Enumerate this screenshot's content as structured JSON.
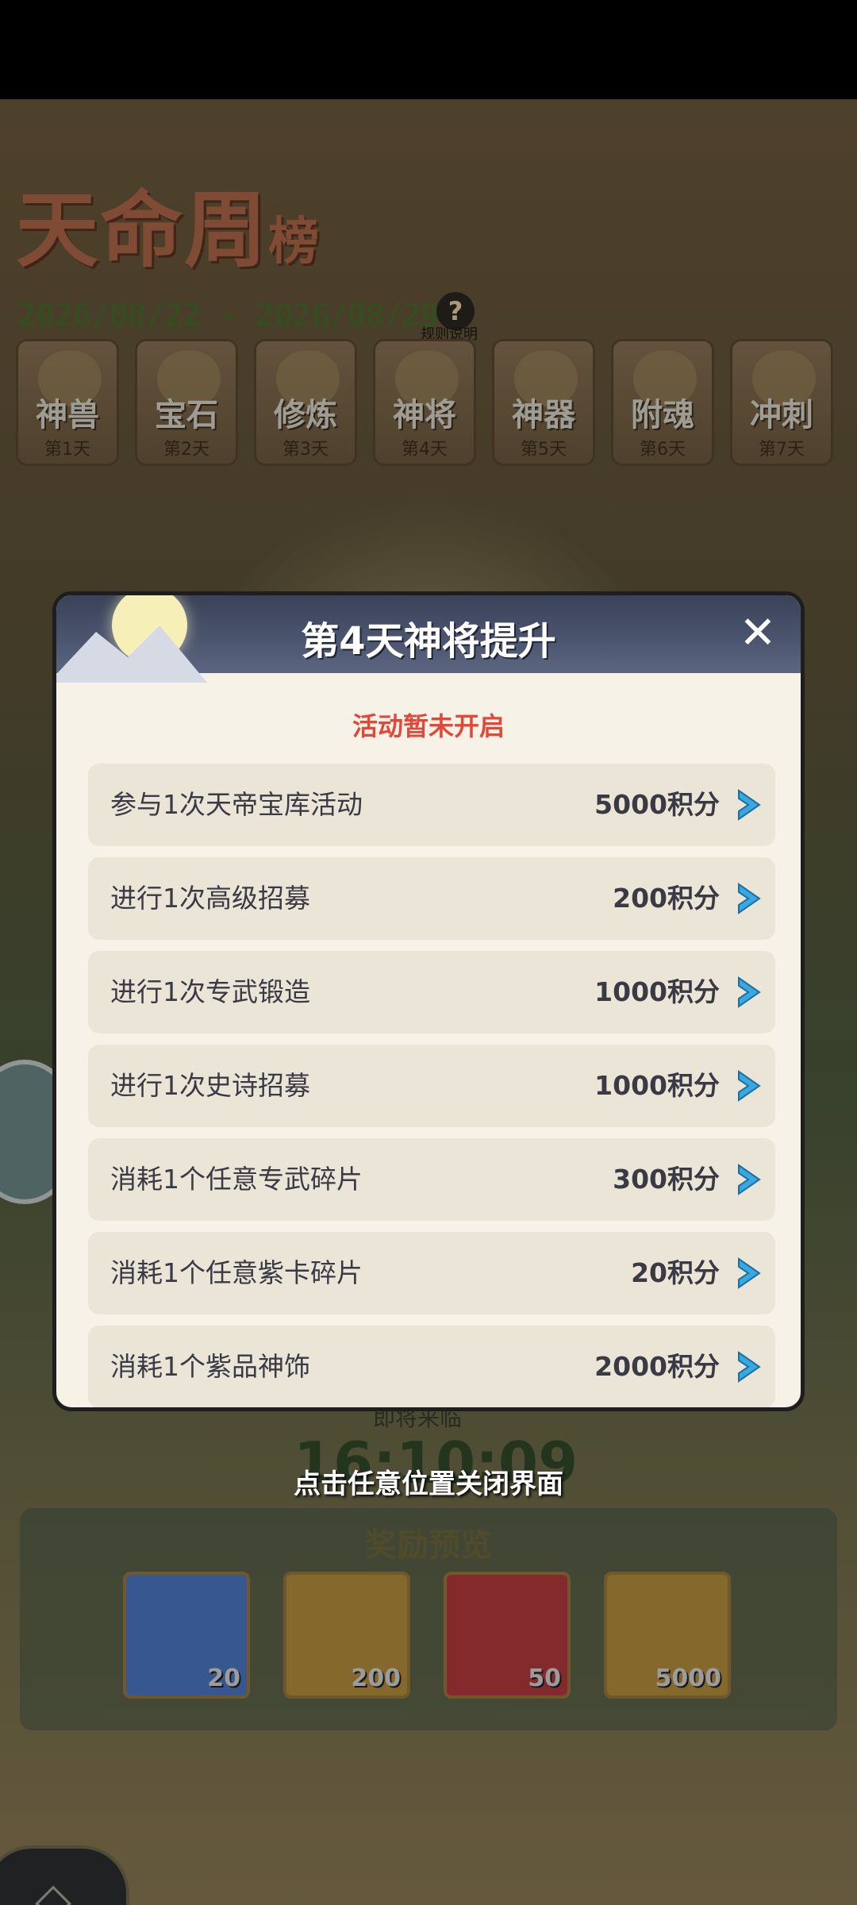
{
  "background": {
    "title_main": "天命周",
    "title_small": "榜",
    "date_range": "2026/08/22 - 2026/08/29",
    "help_label": "规则说明",
    "day_tabs": [
      {
        "name": "神兽",
        "day": "第1天"
      },
      {
        "name": "宝石",
        "day": "第2天"
      },
      {
        "name": "修炼",
        "day": "第3天"
      },
      {
        "name": "神将",
        "day": "第4天"
      },
      {
        "name": "神器",
        "day": "第5天"
      },
      {
        "name": "附魂",
        "day": "第6天"
      },
      {
        "name": "冲刺",
        "day": "第7天"
      }
    ],
    "countdown_label": "即将来临",
    "countdown": "16:10:09",
    "reward_title": "奖励预览",
    "rewards": [
      {
        "qty": "20",
        "color": "#4d79c8"
      },
      {
        "qty": "200",
        "color": "#b8913e"
      },
      {
        "qty": "50",
        "color": "#b83a3e"
      },
      {
        "qty": "5000",
        "color": "#b8913e"
      }
    ]
  },
  "modal": {
    "title": "第4天神将提升",
    "status": "活动暂未开启",
    "tasks": [
      {
        "label": "参与1次天帝宝库活动",
        "points": "5000积分"
      },
      {
        "label": "进行1次高级招募",
        "points": "200积分"
      },
      {
        "label": "进行1次专武锻造",
        "points": "1000积分"
      },
      {
        "label": "进行1次史诗招募",
        "points": "1000积分"
      },
      {
        "label": "消耗1个任意专武碎片",
        "points": "300积分"
      },
      {
        "label": "消耗1个任意紫卡碎片",
        "points": "20积分"
      },
      {
        "label": "消耗1个紫品神饰",
        "points": "2000积分"
      }
    ]
  },
  "close_hint": "点击任意位置关闭界面",
  "colors": {
    "status_red": "#e0483a",
    "arrow_blue": "#3aa8e0",
    "header_blue": "#4c5670"
  }
}
